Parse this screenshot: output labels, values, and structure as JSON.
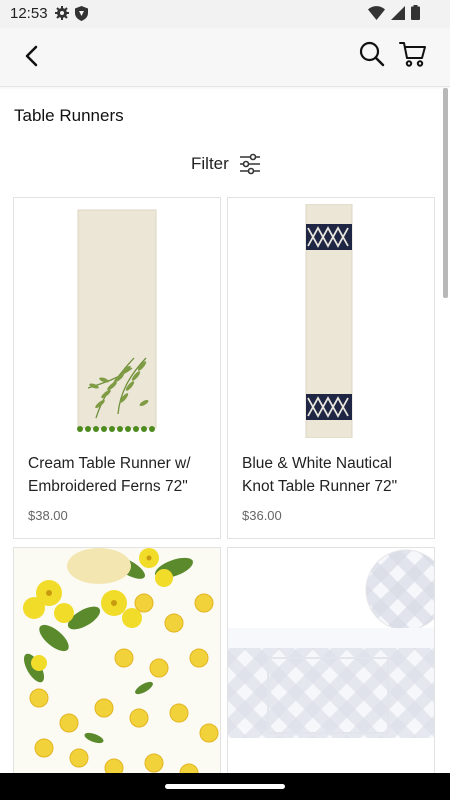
{
  "status": {
    "time": "12:53"
  },
  "header": {
    "title": "Table Runners",
    "filter_label": "Filter"
  },
  "products": [
    {
      "name": "Cream Table Runner w/ Embroidered Ferns 72\"",
      "price": "$38.00"
    },
    {
      "name": "Blue & White Nautical Knot Table Runner 72\"",
      "price": "$36.00"
    },
    {
      "name": "",
      "price": ""
    },
    {
      "name": "",
      "price": ""
    }
  ],
  "colors": {
    "navy": "#1f2644",
    "fern": "#6e8f3a",
    "cream": "#ece6d6",
    "lemon": "#f2d23a"
  },
  "icons": [
    "gear-icon",
    "shield-icon",
    "wifi-icon",
    "signal-icon",
    "battery-icon",
    "back-icon",
    "search-icon",
    "cart-icon",
    "filter-icon"
  ]
}
